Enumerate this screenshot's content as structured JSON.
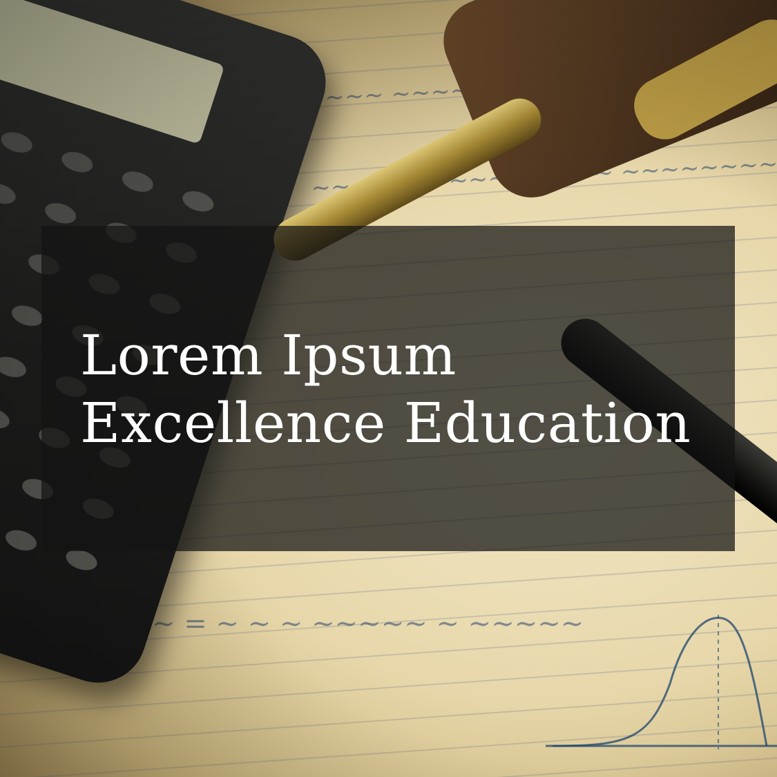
{
  "headline": {
    "line1": "Lorem Ipsum",
    "line2": "Excellence Education"
  },
  "colors": {
    "overlay": "#141414",
    "text": "#ffffff"
  }
}
